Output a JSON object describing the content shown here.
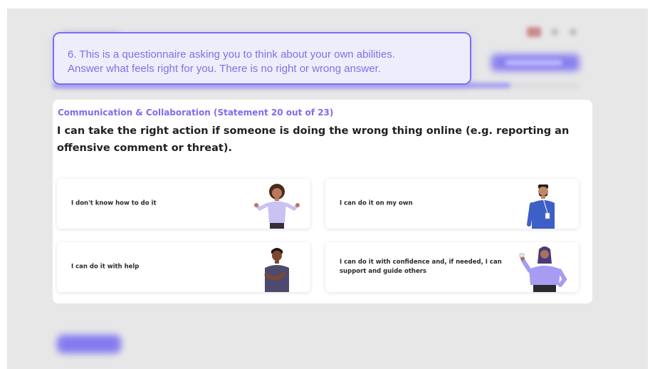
{
  "tooltip": {
    "line1": "6. This is a questionnaire asking you to think about your own abilities.",
    "line2": "Answer what feels right for you. There is no right or wrong answer."
  },
  "question": {
    "category": "Communication & Collaboration (Statement 20 out of 23)",
    "statement": "I can take the right action if someone is doing the wrong thing online (e.g. reporting an offensive comment or threat)."
  },
  "options": [
    {
      "label": "I don't know how to do it",
      "icon": "shrugging-person-icon"
    },
    {
      "label": "I can do it on my own",
      "icon": "standing-person-icon"
    },
    {
      "label": "I can do it with help",
      "icon": "thinking-person-icon"
    },
    {
      "label": "I can do it with confidence and, if needed, I can support and guide others",
      "icon": "waving-person-icon"
    }
  ],
  "progress": {
    "current": 20,
    "total": 23
  },
  "colors": {
    "accent": "#7a6df2",
    "callout_bg": "#eeedfb",
    "backdrop": "#e7e7e8"
  }
}
